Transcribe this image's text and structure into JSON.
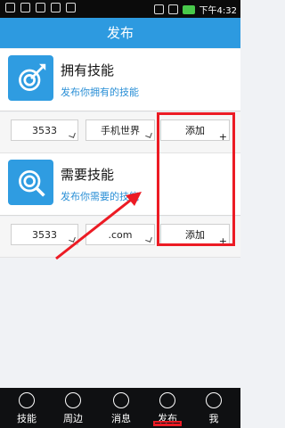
{
  "status_bar": {
    "time": "下午4:32"
  },
  "header": {
    "title": "发布"
  },
  "sections": [
    {
      "title": "拥有技能",
      "desc": "发布你拥有的技能",
      "row": {
        "field1": "3533",
        "field2": "手机世界",
        "add": "添加"
      }
    },
    {
      "title": "需要技能",
      "desc": "发布你需要的技能",
      "row": {
        "field1": "3533",
        "field2": ".com",
        "add": "添加"
      }
    }
  ],
  "tabs": [
    {
      "label": "技能"
    },
    {
      "label": "周边"
    },
    {
      "label": "消息"
    },
    {
      "label": "发布"
    },
    {
      "label": "我"
    }
  ],
  "colors": {
    "accent": "#2d9ae0",
    "highlight": "#ec1b24"
  }
}
